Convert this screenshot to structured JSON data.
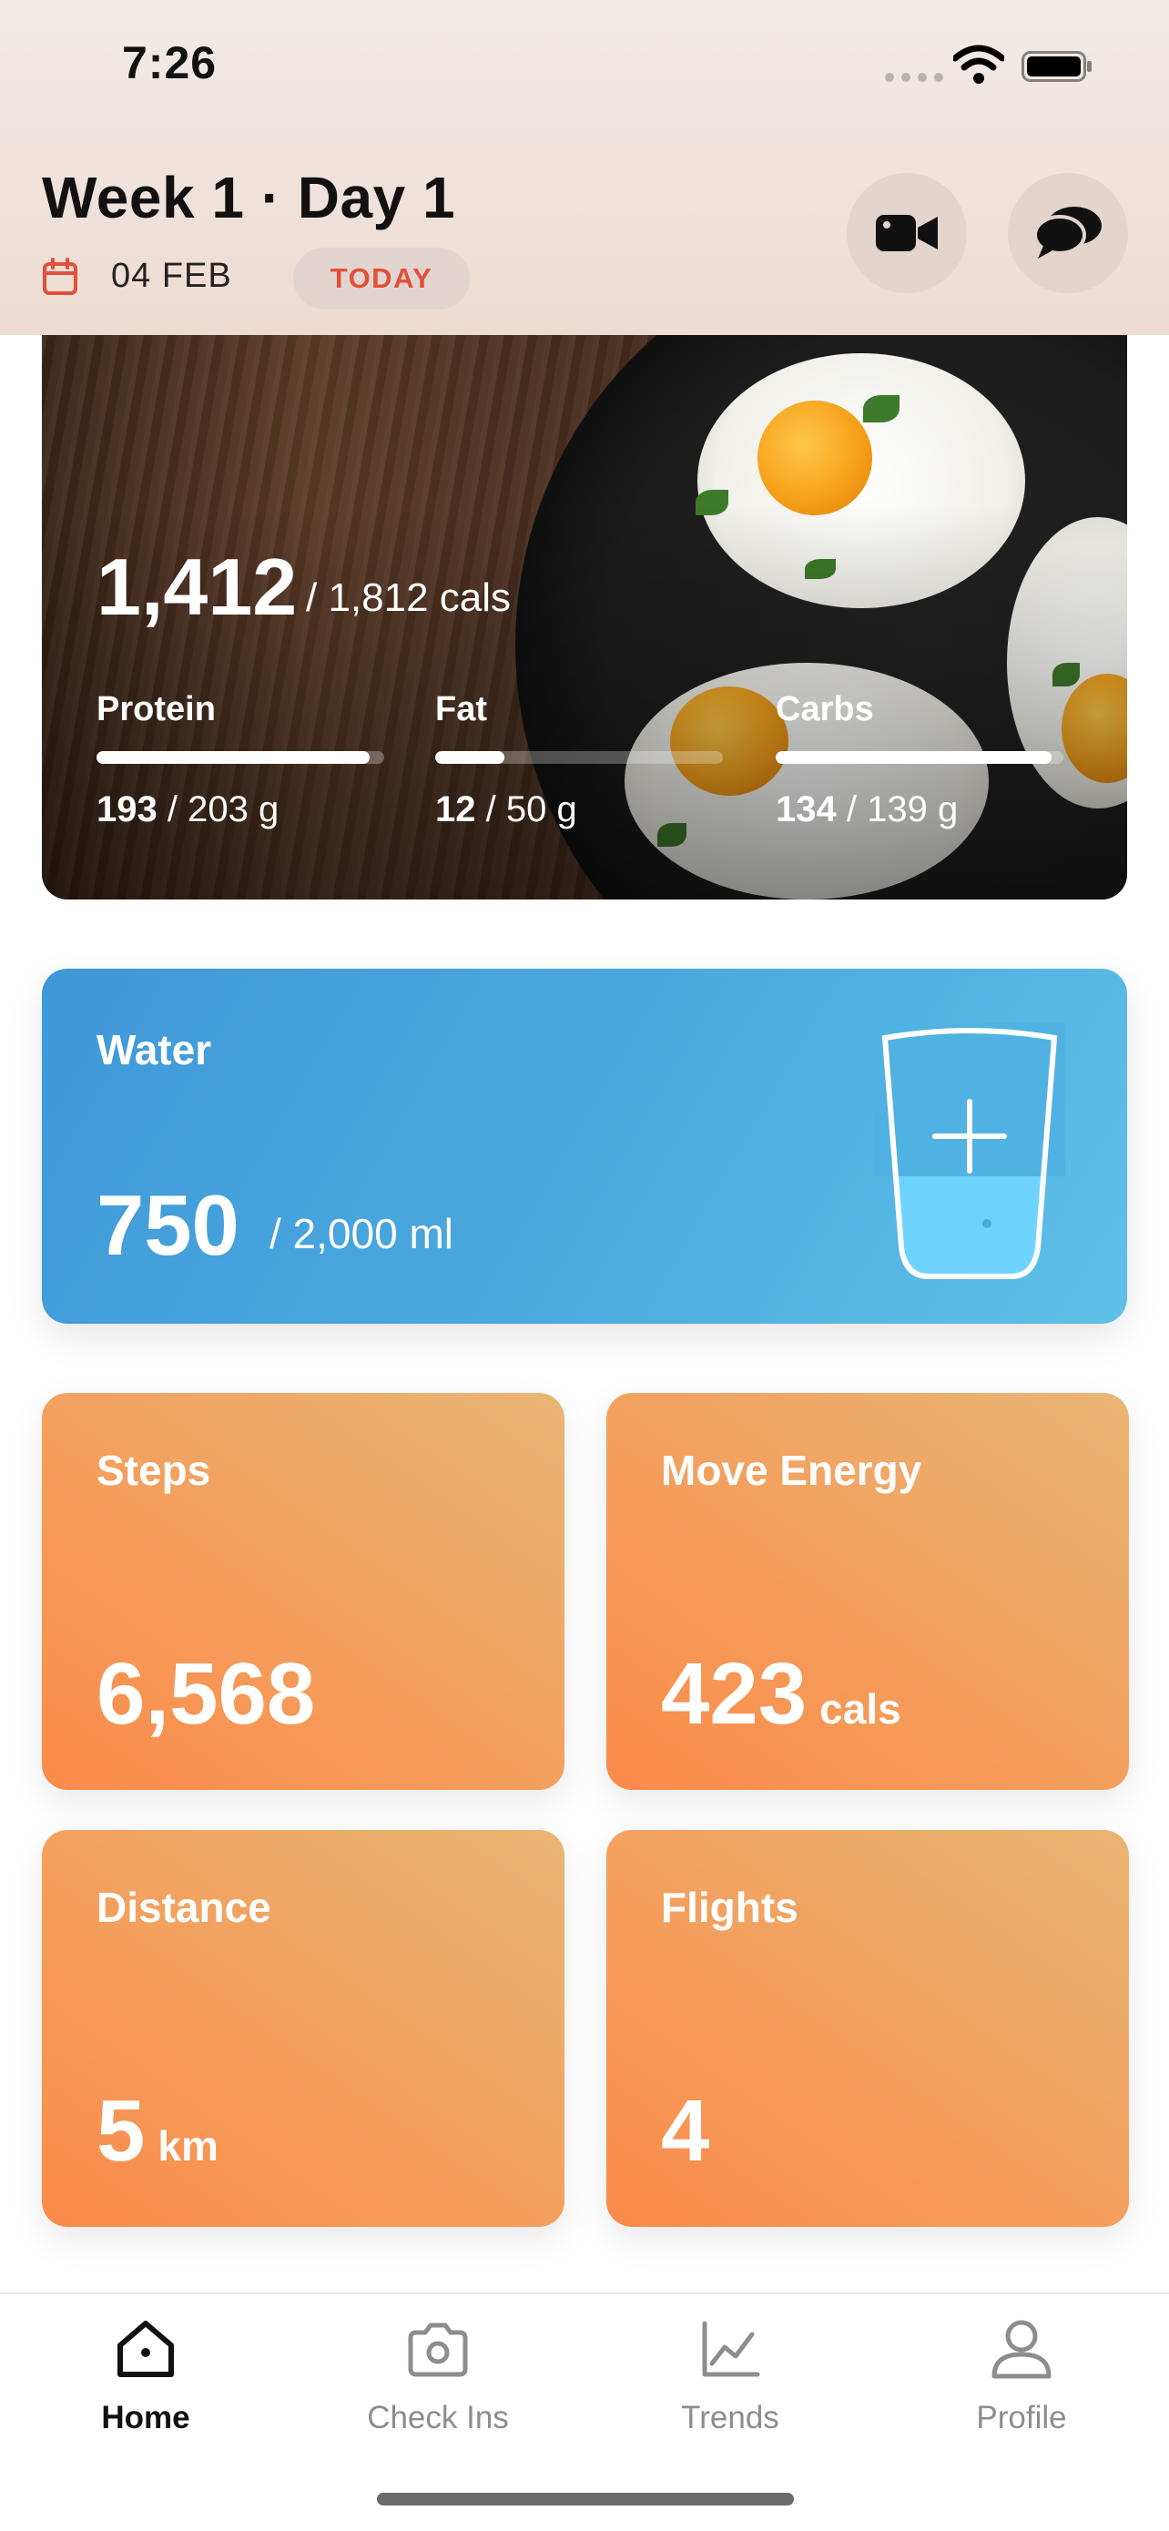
{
  "status_bar": {
    "time": "7:26"
  },
  "header": {
    "title": "Week 1 · Day 1",
    "date": "04 FEB",
    "today_label": "TODAY",
    "video_icon": "video-camera-icon",
    "chat_icon": "chat-bubbles-icon"
  },
  "nutrition": {
    "calories_eaten": "1,412",
    "calories_goal": "/ 1,812 cals",
    "macros": [
      {
        "label": "Protein",
        "current": "193",
        "goal": "/ 203 g",
        "progress": 0.95
      },
      {
        "label": "Fat",
        "current": "12",
        "goal": "/ 50 g",
        "progress": 0.24
      },
      {
        "label": "Carbs",
        "current": "134",
        "goal": "/ 139 g",
        "progress": 0.96
      }
    ]
  },
  "water": {
    "label": "Water",
    "value": "750",
    "goal": "/ 2,000 ml",
    "progress": 0.375,
    "add_icon": "plus-icon"
  },
  "activity": {
    "steps": {
      "label": "Steps",
      "value": "6,568",
      "unit": ""
    },
    "move_energy": {
      "label": "Move Energy",
      "value": "423",
      "unit": "cals"
    },
    "distance": {
      "label": "Distance",
      "value": "5",
      "unit": "km"
    },
    "flights": {
      "label": "Flights",
      "value": "4",
      "unit": ""
    }
  },
  "tabs": [
    {
      "label": "Home",
      "icon": "home-icon",
      "active": true
    },
    {
      "label": "Check Ins",
      "icon": "camera-icon",
      "active": false
    },
    {
      "label": "Trends",
      "icon": "chart-icon",
      "active": false
    },
    {
      "label": "Profile",
      "icon": "person-icon",
      "active": false
    }
  ],
  "colors": {
    "accent_red": "#e24f3a",
    "water_blue": "#4aa9de",
    "activity_orange": "#f49e5c"
  }
}
